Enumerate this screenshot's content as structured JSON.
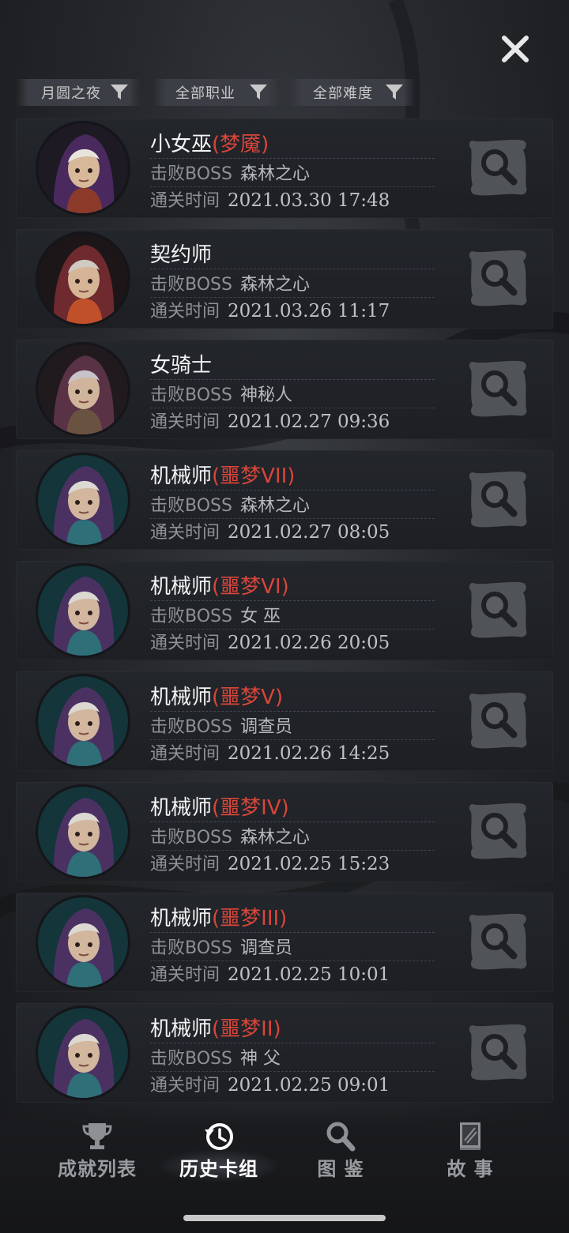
{
  "filters": [
    {
      "label": "月圆之夜"
    },
    {
      "label": "全部职业"
    },
    {
      "label": "全部难度"
    }
  ],
  "records": [
    {
      "hero": "小女巫",
      "tier": "(梦魇)",
      "boss_label": "击败BOSS",
      "boss": "森林之心",
      "time_label": "通关时间",
      "time": "2021.03.30 17:48",
      "avatar": "witch"
    },
    {
      "hero": "契约师",
      "tier": "",
      "boss_label": "击败BOSS",
      "boss": "森林之心",
      "time_label": "通关时间",
      "time": "2021.03.26 11:17",
      "avatar": "contractor"
    },
    {
      "hero": "女骑士",
      "tier": "",
      "boss_label": "击败BOSS",
      "boss": "神秘人",
      "time_label": "通关时间",
      "time": "2021.02.27 09:36",
      "avatar": "knight"
    },
    {
      "hero": "机械师",
      "tier": "(噩梦VII)",
      "boss_label": "击败BOSS",
      "boss": "森林之心",
      "time_label": "通关时间",
      "time": "2021.02.27 08:05",
      "avatar": "mechanic"
    },
    {
      "hero": "机械师",
      "tier": "(噩梦VI)",
      "boss_label": "击败BOSS",
      "boss": "女 巫",
      "time_label": "通关时间",
      "time": "2021.02.26 20:05",
      "avatar": "mechanic"
    },
    {
      "hero": "机械师",
      "tier": "(噩梦V)",
      "boss_label": "击败BOSS",
      "boss": "调查员",
      "time_label": "通关时间",
      "time": "2021.02.26 14:25",
      "avatar": "mechanic"
    },
    {
      "hero": "机械师",
      "tier": "(噩梦IV)",
      "boss_label": "击败BOSS",
      "boss": "森林之心",
      "time_label": "通关时间",
      "time": "2021.02.25 15:23",
      "avatar": "mechanic"
    },
    {
      "hero": "机械师",
      "tier": "(噩梦III)",
      "boss_label": "击败BOSS",
      "boss": "调查员",
      "time_label": "通关时间",
      "time": "2021.02.25 10:01",
      "avatar": "mechanic"
    },
    {
      "hero": "机械师",
      "tier": "(噩梦II)",
      "boss_label": "击败BOSS",
      "boss": "神 父",
      "time_label": "通关时间",
      "time": "2021.02.25 09:01",
      "avatar": "mechanic"
    }
  ],
  "nav": [
    {
      "label": "成就列表",
      "icon": "trophy-icon",
      "active": false
    },
    {
      "label": "历史卡组",
      "icon": "history-icon",
      "active": true
    },
    {
      "label": "图 鉴",
      "icon": "magnifier-icon",
      "active": false
    },
    {
      "label": "故 事",
      "icon": "book-icon",
      "active": false
    }
  ],
  "colors": {
    "tier_red": "#d8463b",
    "background": "#26282c",
    "card": "#202327"
  }
}
